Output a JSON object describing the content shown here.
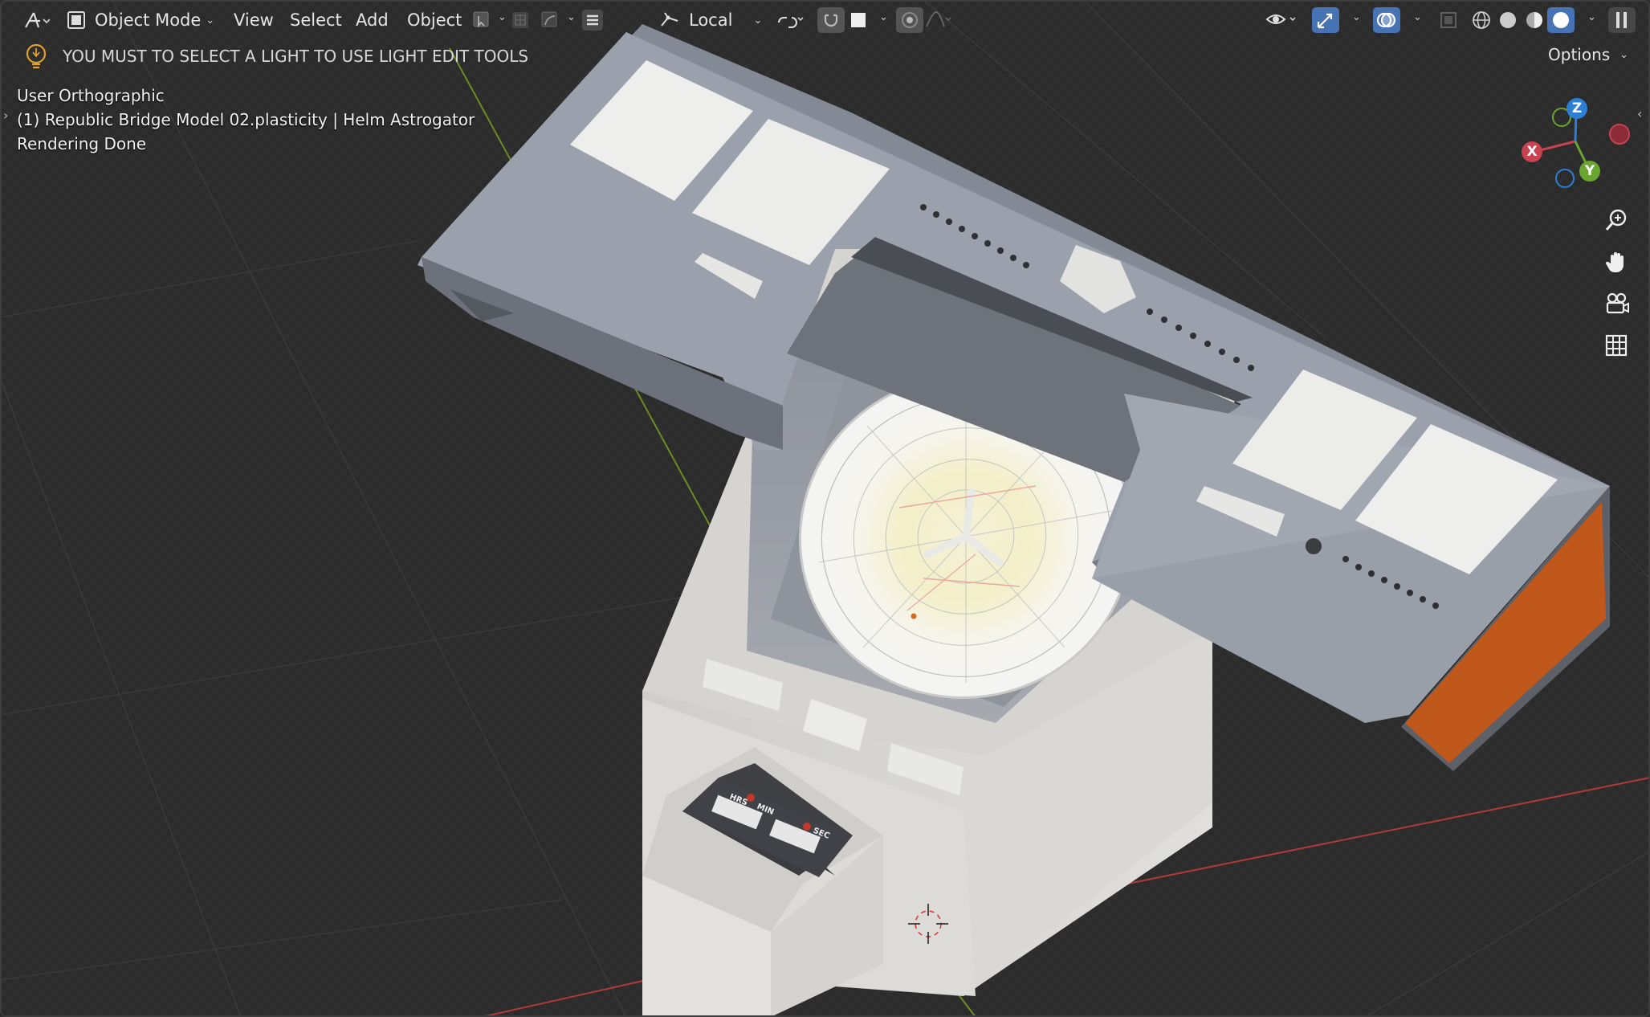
{
  "toolbar": {
    "editor_type_icon": "transform-orientation-icon",
    "mode": "Object Mode",
    "menus": [
      "View",
      "Select",
      "Add",
      "Object"
    ],
    "transform_orientation": "Local"
  },
  "header_bar": {
    "warning": "YOU MUST TO SELECT A LIGHT TO USE LIGHT EDIT TOOLS",
    "options_label": "Options"
  },
  "viewport_info": {
    "view_name": "User Orthographic",
    "object_line": "(1) Republic Bridge Model 02.plasticity | Helm Astrogator",
    "status": "Rendering Done"
  },
  "gizmo": {
    "x_label": "X",
    "y_label": "Y",
    "z_label": "Z",
    "x_color": "#c84250",
    "y_color": "#6aa532",
    "z_color": "#2d7fd3"
  },
  "nav_buttons": [
    "zoom-icon",
    "hand-pan-icon",
    "camera-view-icon",
    "grid-view-icon"
  ],
  "panel_labels": {
    "hrs": "HRS",
    "min": "MIN",
    "sec": "SEC"
  },
  "colors": {
    "viewport_bg": "#2b2b2b",
    "accent_blue": "#4772b3",
    "orange_panel": "#c0581c",
    "console_top": "#9aa0ab",
    "console_body": "#d7d6d3"
  }
}
